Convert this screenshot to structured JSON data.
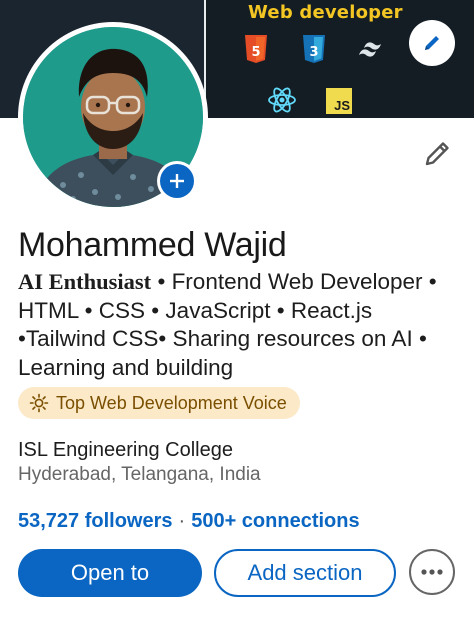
{
  "banner": {
    "title": "Web developer",
    "tech_icons": [
      "html5-icon",
      "css3-icon",
      "tailwind-icon",
      "react-icon",
      "javascript-icon"
    ],
    "js_label": "JS"
  },
  "profile": {
    "name": "Mohammed Wajid",
    "headline_bold": "AI Enthusiast",
    "headline_rest": " • Frontend Web Developer • HTML • CSS • JavaScript • React.js •Tailwind CSS• Sharing resources on AI • Learning and building",
    "badge": "Top Web Development Voice",
    "school": "ISL Engineering College",
    "location": "Hyderabad, Telangana, India",
    "followers": "53,727 followers",
    "separator": "·",
    "connections": "500+ connections"
  },
  "actions": {
    "primary": "Open to",
    "secondary": "Add section",
    "more_icon": "more-horizontal-icon"
  },
  "colors": {
    "accent": "#0a66c2",
    "banner_bg": "#141d24",
    "banner_title": "#f3c623",
    "avatar_bg": "#1f9b8c",
    "badge_bg": "#fbe9c8",
    "badge_text": "#7a4f00"
  }
}
